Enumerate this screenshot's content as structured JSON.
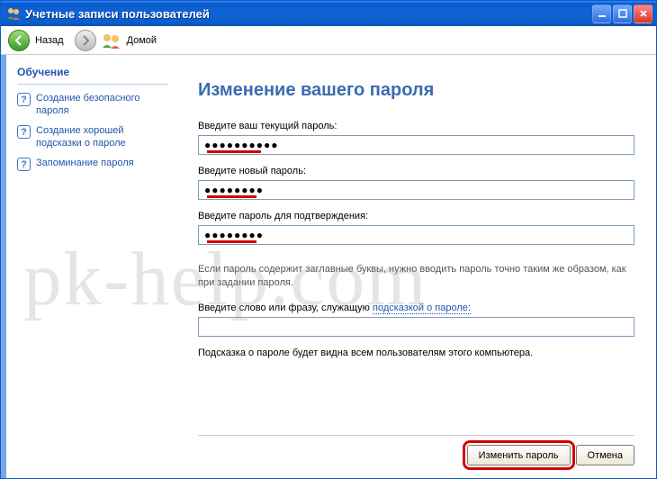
{
  "titlebar": {
    "title": "Учетные записи пользователей"
  },
  "toolbar": {
    "back_label": "Назад",
    "home_label": "Домой"
  },
  "sidebar": {
    "heading": "Обучение",
    "items": [
      {
        "label": "Создание безопасного пароля"
      },
      {
        "label": "Создание хорошей подсказки о пароле"
      },
      {
        "label": "Запоминание пароля"
      }
    ]
  },
  "main": {
    "heading": "Изменение вашего пароля",
    "current_label": "Введите ваш текущий пароль:",
    "current_value": "●●●●●●●●●●",
    "new_label": "Введите новый пароль:",
    "new_value": "●●●●●●●●",
    "confirm_label": "Введите пароль для подтверждения:",
    "confirm_value": "●●●●●●●●",
    "caps_note": "Если пароль содержит заглавные буквы, нужно вводить пароль точно таким же образом, как при задании пароля.",
    "hint_label_pre": "Введите слово или фразу, служащую ",
    "hint_link": "подсказкой о пароле:",
    "hint_value": "",
    "hint_note": "Подсказка о пароле будет видна всем пользователям этого компьютера."
  },
  "buttons": {
    "change": "Изменить пароль",
    "cancel": "Отмена"
  },
  "watermark": "pk-help.com"
}
